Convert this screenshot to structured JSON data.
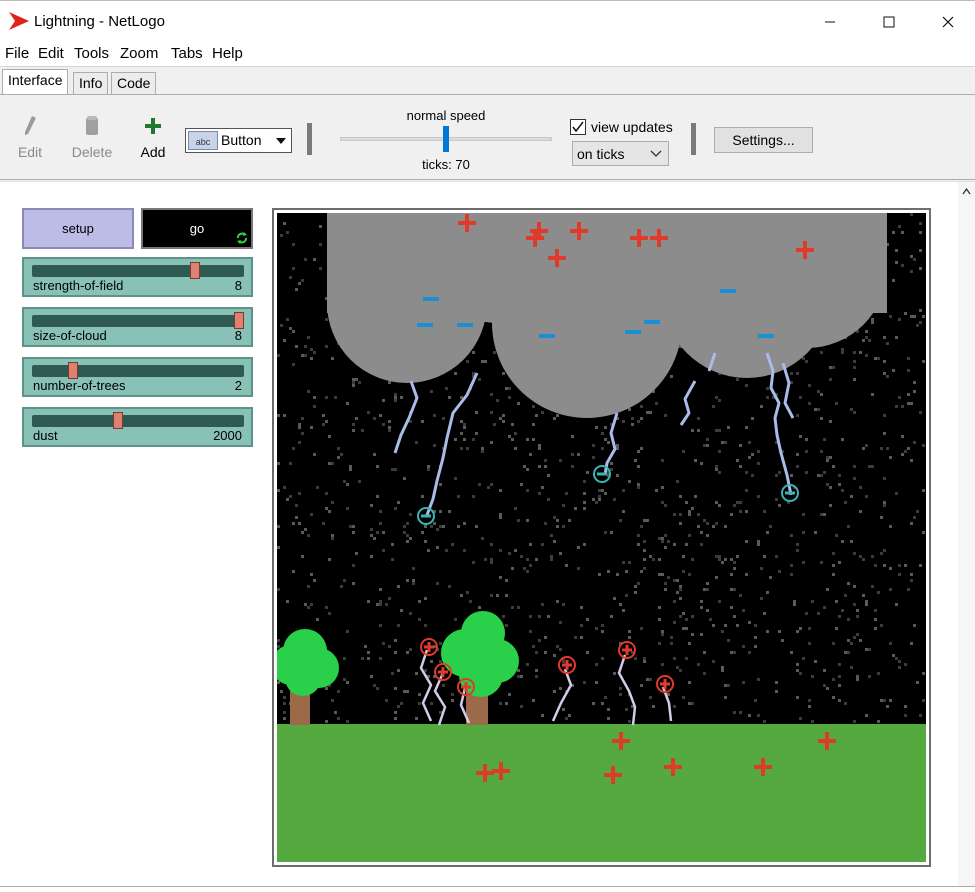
{
  "window": {
    "title": "Lightning - NetLogo"
  },
  "menu": [
    "File",
    "Edit",
    "Tools",
    "Zoom",
    "Tabs",
    "Help"
  ],
  "tabs": [
    "Interface",
    "Info",
    "Code"
  ],
  "toolbar": {
    "edit_label": "Edit",
    "delete_label": "Delete",
    "add_label": "Add",
    "widget_type": "Button",
    "widget_type_icon_text": "abc",
    "speed_label": "normal speed",
    "speed_fraction": 0.5,
    "ticks_label": "ticks: 70",
    "view_updates_label": "view updates",
    "view_updates_checked": true,
    "update_mode": "on ticks",
    "settings_label": "Settings..."
  },
  "widgets": {
    "setup_label": "setup",
    "go_label": "go",
    "sliders": [
      {
        "name": "strength-of-field",
        "value": "8",
        "fraction": 0.78
      },
      {
        "name": "size-of-cloud",
        "value": "8",
        "fraction": 1.0
      },
      {
        "name": "number-of-trees",
        "value": "2",
        "fraction": 0.18
      },
      {
        "name": "dust",
        "value": "2000",
        "fraction": 0.4
      }
    ]
  },
  "colors": {
    "sky": "#000000",
    "cloud": "#8c8c8c",
    "ground": "#55aa3f",
    "lightning": "#a9bce8",
    "plus": "#e03a2a",
    "minus": "#1a8fd6",
    "tree_foliage": "#2ad04a",
    "tree_trunk": "#9b6a48",
    "setup_button": "#bcbce6",
    "slider": "#88c2b7"
  }
}
